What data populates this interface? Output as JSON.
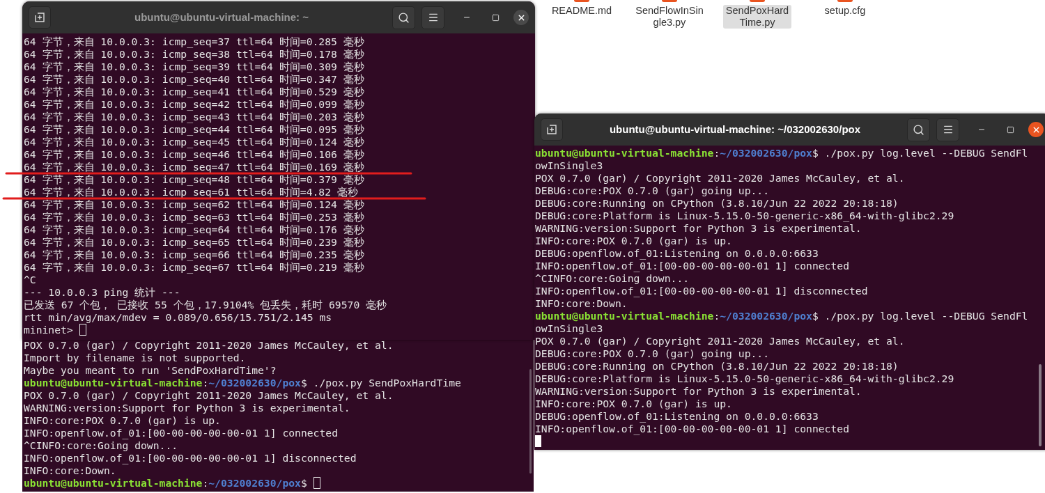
{
  "files": [
    {
      "name": "README.md",
      "selected": false
    },
    {
      "name": "SendFlowInSin\ngle3.py",
      "selected": false
    },
    {
      "name": "SendPoxHard\nTime.py",
      "selected": true
    },
    {
      "name": "setup.cfg",
      "selected": false
    }
  ],
  "back_terminal": {
    "lines": [
      {
        "kind": "output",
        "text": "POX 0.7.0 (gar) / Copyright 2011-2020 James McCauley, et al."
      },
      {
        "kind": "output",
        "text": "Import by filename is not supported."
      },
      {
        "kind": "output",
        "text": "Maybe you meant to run 'SendPoxHardTime'?"
      },
      {
        "kind": "prompt",
        "host": "ubuntu@ubuntu-virtual-machine",
        "sep": ":",
        "path": "~/032002630/pox",
        "command": "$ ./pox.py SendPoxHardTime"
      },
      {
        "kind": "output",
        "text": "POX 0.7.0 (gar) / Copyright 2011-2020 James McCauley, et al."
      },
      {
        "kind": "output",
        "text": "WARNING:version:Support for Python 3 is experimental."
      },
      {
        "kind": "output",
        "text": "INFO:core:POX 0.7.0 (gar) is up."
      },
      {
        "kind": "output",
        "text": "INFO:openflow.of_01:[00-00-00-00-00-01 1] connected"
      },
      {
        "kind": "output",
        "text": "^CINFO:core:Going down..."
      },
      {
        "kind": "output",
        "text": "INFO:openflow.of_01:[00-00-00-00-00-01 1] disconnected"
      },
      {
        "kind": "output",
        "text": "INFO:core:Down."
      },
      {
        "kind": "prompt",
        "host": "ubuntu@ubuntu-virtual-machine",
        "sep": ":",
        "path": "~/032002630/pox",
        "command": "$ ",
        "cursor": true
      }
    ],
    "active": false
  },
  "ping_terminal": {
    "title": "ubuntu@ubuntu-virtual-machine: ~",
    "active": false,
    "lines": [
      {
        "kind": "output",
        "text": "64 字节，来自 10.0.0.3: icmp_seq=37 ttl=64 时间=0.285 毫秒"
      },
      {
        "kind": "output",
        "text": "64 字节，来自 10.0.0.3: icmp_seq=38 ttl=64 时间=0.178 毫秒"
      },
      {
        "kind": "output",
        "text": "64 字节，来自 10.0.0.3: icmp_seq=39 ttl=64 时间=0.309 毫秒"
      },
      {
        "kind": "output",
        "text": "64 字节，来自 10.0.0.3: icmp_seq=40 ttl=64 时间=0.347 毫秒"
      },
      {
        "kind": "output",
        "text": "64 字节，来自 10.0.0.3: icmp_seq=41 ttl=64 时间=0.529 毫秒"
      },
      {
        "kind": "output",
        "text": "64 字节，来自 10.0.0.3: icmp_seq=42 ttl=64 时间=0.099 毫秒"
      },
      {
        "kind": "output",
        "text": "64 字节，来自 10.0.0.3: icmp_seq=43 ttl=64 时间=0.203 毫秒"
      },
      {
        "kind": "output",
        "text": "64 字节，来自 10.0.0.3: icmp_seq=44 ttl=64 时间=0.095 毫秒"
      },
      {
        "kind": "output",
        "text": "64 字节，来自 10.0.0.3: icmp_seq=45 ttl=64 时间=0.124 毫秒"
      },
      {
        "kind": "output",
        "text": "64 字节，来自 10.0.0.3: icmp_seq=46 ttl=64 时间=0.106 毫秒"
      },
      {
        "kind": "output",
        "text": "64 字节，来自 10.0.0.3: icmp_seq=47 ttl=64 时间=0.169 毫秒"
      },
      {
        "kind": "output",
        "text": "64 字节，来自 10.0.0.3: icmp_seq=48 ttl=64 时间=0.379 毫秒"
      },
      {
        "kind": "output",
        "text": "64 字节，来自 10.0.0.3: icmp_seq=61 ttl=64 时间=4.82 毫秒"
      },
      {
        "kind": "output",
        "text": "64 字节，来自 10.0.0.3: icmp_seq=62 ttl=64 时间=0.124 毫秒"
      },
      {
        "kind": "output",
        "text": "64 字节，来自 10.0.0.3: icmp_seq=63 ttl=64 时间=0.253 毫秒"
      },
      {
        "kind": "output",
        "text": "64 字节，来自 10.0.0.3: icmp_seq=64 ttl=64 时间=0.176 毫秒"
      },
      {
        "kind": "output",
        "text": "64 字节，来自 10.0.0.3: icmp_seq=65 ttl=64 时间=0.239 毫秒"
      },
      {
        "kind": "output",
        "text": "64 字节，来自 10.0.0.3: icmp_seq=66 ttl=64 时间=0.235 毫秒"
      },
      {
        "kind": "output",
        "text": "64 字节，来自 10.0.0.3: icmp_seq=67 ttl=64 时间=0.219 毫秒"
      },
      {
        "kind": "output",
        "text": "^C"
      },
      {
        "kind": "output",
        "text": "--- 10.0.0.3 ping 统计 ---"
      },
      {
        "kind": "output",
        "text": "已发送 67 个包， 已接收 55 个包，17.9104% 包丢失，耗时 69570 毫秒"
      },
      {
        "kind": "output",
        "text": "rtt min/avg/max/mdev = 0.089/0.656/15.751/2.145 ms"
      },
      {
        "kind": "output",
        "text": "mininet> ",
        "cursor": true
      }
    ]
  },
  "pox_terminal": {
    "title": "ubuntu@ubuntu-virtual-machine: ~/032002630/pox",
    "active": true,
    "lines": [
      {
        "kind": "prompt",
        "host": "ubuntu@ubuntu-virtual-machine",
        "sep": ":",
        "path": "~/032002630/pox",
        "command": "$ ./pox.py log.level --DEBUG SendFl"
      },
      {
        "kind": "output",
        "text": "owInSingle3"
      },
      {
        "kind": "output",
        "text": "POX 0.7.0 (gar) / Copyright 2011-2020 James McCauley, et al."
      },
      {
        "kind": "output",
        "text": "DEBUG:core:POX 0.7.0 (gar) going up..."
      },
      {
        "kind": "output",
        "text": "DEBUG:core:Running on CPython (3.8.10/Jun 22 2022 20:18:18)"
      },
      {
        "kind": "output",
        "text": "DEBUG:core:Platform is Linux-5.15.0-50-generic-x86_64-with-glibc2.29"
      },
      {
        "kind": "output",
        "text": "WARNING:version:Support for Python 3 is experimental."
      },
      {
        "kind": "output",
        "text": "INFO:core:POX 0.7.0 (gar) is up."
      },
      {
        "kind": "output",
        "text": "DEBUG:openflow.of_01:Listening on 0.0.0.0:6633"
      },
      {
        "kind": "output",
        "text": "INFO:openflow.of_01:[00-00-00-00-00-01 1] connected"
      },
      {
        "kind": "output",
        "text": "^CINFO:core:Going down..."
      },
      {
        "kind": "output",
        "text": "INFO:openflow.of_01:[00-00-00-00-00-01 1] disconnected"
      },
      {
        "kind": "output",
        "text": "INFO:core:Down."
      },
      {
        "kind": "prompt",
        "host": "ubuntu@ubuntu-virtual-machine",
        "sep": ":",
        "path": "~/032002630/pox",
        "command": "$ ./pox.py log.level --DEBUG SendFl"
      },
      {
        "kind": "output",
        "text": "owInSingle3"
      },
      {
        "kind": "output",
        "text": "POX 0.7.0 (gar) / Copyright 2011-2020 James McCauley, et al."
      },
      {
        "kind": "output",
        "text": "DEBUG:core:POX 0.7.0 (gar) going up..."
      },
      {
        "kind": "output",
        "text": "DEBUG:core:Running on CPython (3.8.10/Jun 22 2022 20:18:18)"
      },
      {
        "kind": "output",
        "text": "DEBUG:core:Platform is Linux-5.15.0-50-generic-x86_64-with-glibc2.29"
      },
      {
        "kind": "output",
        "text": "WARNING:version:Support for Python 3 is experimental."
      },
      {
        "kind": "output",
        "text": "INFO:core:POX 0.7.0 (gar) is up."
      },
      {
        "kind": "output",
        "text": "DEBUG:openflow.of_01:Listening on 0.0.0.0:6633"
      },
      {
        "kind": "output",
        "text": "INFO:openflow.of_01:[00-00-00-00-00-01 1] connected"
      },
      {
        "kind": "cursor"
      }
    ]
  }
}
